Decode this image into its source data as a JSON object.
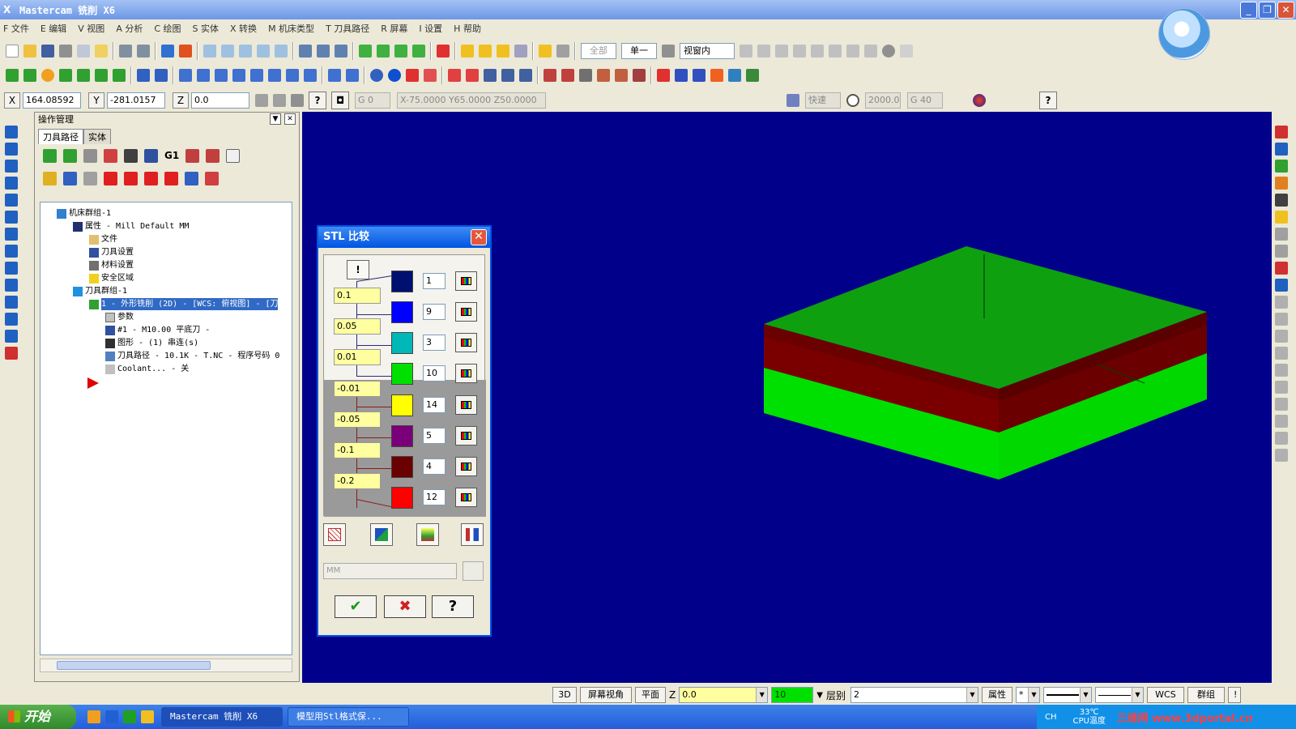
{
  "window": {
    "title": "Mastercam 铣削 X6"
  },
  "menu": [
    "F 文件",
    "E 编辑",
    "V 视图",
    "A 分析",
    "C 绘图",
    "S 实体",
    "X 转换",
    "M 机床类型",
    "T 刀具路径",
    "R 屏幕",
    "I 设置",
    "H 帮助"
  ],
  "toolbar": {
    "all_label": "全部",
    "single_label": "单一",
    "view_select": "视窗内"
  },
  "coords": {
    "x_label": "X",
    "x_value": "164.08592",
    "y_label": "Y",
    "y_value": "-281.0157",
    "z_label": "Z",
    "z_value": "0.0",
    "g_field": "G 0",
    "xyz_readout": "X-75.0000  Y65.0000  Z50.0000",
    "rapid": "快速",
    "feed": "2000.0",
    "g40": "G 40"
  },
  "op_manager": {
    "title": "操作管理",
    "tabs": [
      "刀具路径",
      "实体"
    ],
    "tree": {
      "machine_group": "机床群组-1",
      "properties": "属性 - Mill Default MM",
      "files": "文件",
      "tool_settings": "刀具设置",
      "stock_settings": "材料设置",
      "safety_zone": "安全区域",
      "toolpath_group": "刀具群组-1",
      "operation": "1 - 外形铣削 (2D) - [WCS: 俯视图] - [刀",
      "params": "参数",
      "tool": "#1 - M10.00 平底刀 -",
      "geometry": "图形 - (1) 串连(s)",
      "toolpath": "刀具路径 - 10.1K - T.NC - 程序号码 0",
      "coolant": "Coolant... - 关"
    }
  },
  "stl_dialog": {
    "title": "STL 比较",
    "tolerances": [
      "0.1",
      "0.05",
      "0.01",
      "-0.01",
      "-0.05",
      "-0.1",
      "-0.2"
    ],
    "levels": [
      {
        "color": "#001070",
        "value": "1"
      },
      {
        "color": "#0000ff",
        "value": "9"
      },
      {
        "color": "#00b8b8",
        "value": "3"
      },
      {
        "color": "#00e000",
        "value": "10"
      },
      {
        "color": "#ffff00",
        "value": "14"
      },
      {
        "color": "#7a007a",
        "value": "5"
      },
      {
        "color": "#6a0000",
        "value": "4"
      },
      {
        "color": "#ff0000",
        "value": "12"
      }
    ],
    "unit_field": "MM"
  },
  "statusbar": {
    "mode_3d": "3D",
    "screen_view": "屏幕视角",
    "plane": "平面",
    "z_label": "Z",
    "z_value": "0.0",
    "color_value": "10",
    "level_label": "层别",
    "level_value": "2",
    "attrib": "属性",
    "wcs": "WCS",
    "group": "群组"
  },
  "taskbar": {
    "start": "开始",
    "task1": "Mastercam 铣削 X6",
    "task2": "模型用Stl格式保...",
    "lang": "CH",
    "cpu_temp": "33℃",
    "cpu_label": "CPU温度",
    "watermark": "三维网 www.3dportal.cn"
  }
}
